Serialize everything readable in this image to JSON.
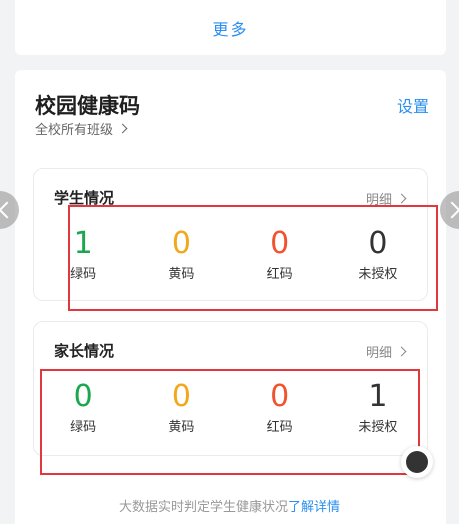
{
  "top": {
    "more_label": "更多"
  },
  "health": {
    "title": "校园健康码",
    "settings_label": "设置",
    "scope_label": "全校所有班级"
  },
  "students": {
    "title": "学生情况",
    "detail_label": "明细",
    "stats": [
      {
        "value": "1",
        "label": "绿码"
      },
      {
        "value": "0",
        "label": "黄码"
      },
      {
        "value": "0",
        "label": "红码"
      },
      {
        "value": "0",
        "label": "未授权"
      }
    ]
  },
  "parents": {
    "title": "家长情况",
    "detail_label": "明细",
    "stats": [
      {
        "value": "0",
        "label": "绿码"
      },
      {
        "value": "0",
        "label": "黄码"
      },
      {
        "value": "0",
        "label": "红码"
      },
      {
        "value": "1",
        "label": "未授权"
      }
    ]
  },
  "footer": {
    "text": "大数据实时判定学生健康状况",
    "link": "了解详情"
  },
  "colors": {
    "accent": "#2b8ff0",
    "green": "#1aa84e",
    "yellow": "#f2a81d",
    "red": "#f0532e",
    "highlight": "#e1383e"
  }
}
